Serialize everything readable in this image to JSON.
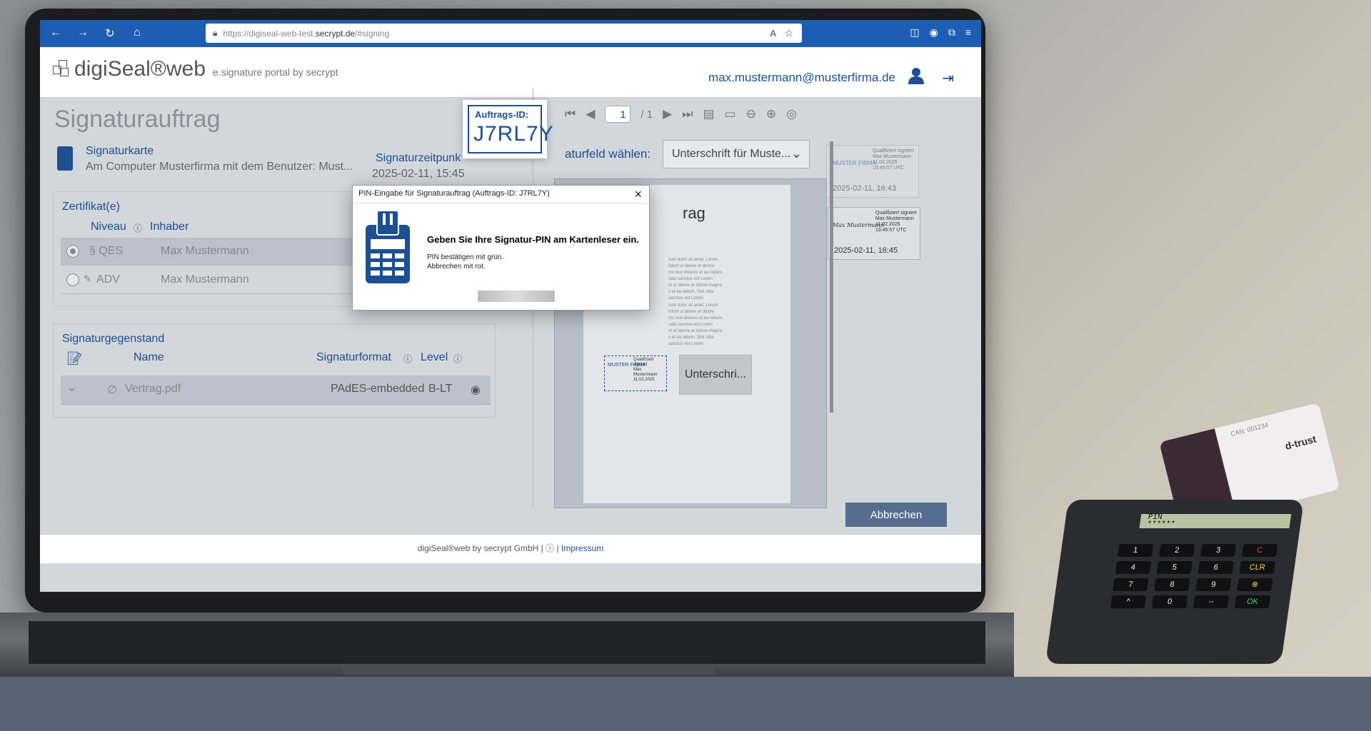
{
  "browser": {
    "url_prefix": "https://digiseal-web-test.",
    "url_domain": "secrypt.de",
    "url_path": "/#signing"
  },
  "header": {
    "logo_name": "digiSeal®web",
    "logo_sub": "e.signature portal by secrypt",
    "user_email": "max.mustermann@musterfirma.de"
  },
  "page": {
    "title": "Signaturauftrag",
    "card_label": "Signaturkarte",
    "card_desc": "Am Computer Musterfirma mit dem Benutzer: Must...",
    "sigtime_label": "Signaturzeitpunk",
    "sigtime_value": "2025-02-11, 15:45"
  },
  "certificates": {
    "title": "Zertifikat(e)",
    "col_level": "Niveau",
    "col_holder": "Inhaber",
    "rows": [
      {
        "level": "§ QES",
        "holder": "Max Mustermann",
        "selected": true
      },
      {
        "level": "ADV",
        "holder": "Max Mustermann",
        "selected": false
      }
    ]
  },
  "object": {
    "title": "Signaturgegenstand",
    "col_name": "Name",
    "col_format": "Signaturformat",
    "col_level": "Level",
    "row": {
      "name": "Vertrag.pdf",
      "format": "PAdES-embedded",
      "level": "B-LT"
    }
  },
  "viewer": {
    "page_current": "1",
    "page_total": "/ 1",
    "sigfield_label": "aturfeld wählen:",
    "sigfield_value": "Unterschrift für Muste...",
    "doc_title": "rag",
    "lorem": "sum dolor sit amet. Lorem\nlidunt ut labore et dolore\nmo duo dolores et ea rebum.\nsata sanctus est Lorem\nnt ut labore et dolore magna\ns et ea rebum. Stet clita\nsanctus est Lorem",
    "stamp1": "Qualifiziert signiert\nMax Mustermann\n11.02.2025",
    "stamp1_mark": "MUSTER FIRMA",
    "sig_button": "Unterschri..."
  },
  "thumbnails": [
    {
      "text": "Qualifiziert signiert\nMax Mustermann\n11.02.2025\n15:45:57 UTC",
      "date": "2025-02-11, 16:43",
      "mark": "MUSTER FIRMA"
    },
    {
      "text": "Qualifiziert signiert\nMax Mustermann\n11.02.2025\n15:45:57 UTC",
      "date": "2025-02-11, 16:45",
      "mark": "Max Mustermann"
    }
  ],
  "cancel_label": "Abbrechen",
  "footer": {
    "text": "digiSeal®web by secrypt GmbH |",
    "link": "Impressum"
  },
  "auftrag": {
    "label": "Auftrags-ID:",
    "value": "J7RL7Y"
  },
  "dialog": {
    "title": "PIN-Eingabe für Signaturauftrag (Auftrags-ID: J7RL7Y)",
    "heading": "Geben Sie Ihre Signatur-PIN am Kartenleser ein.",
    "line1": "PIN bestätigen mit grün.",
    "line2": "Abbrechen mit rot."
  },
  "reader": {
    "display": "PIN\n******",
    "keys": [
      "1",
      "2",
      "3",
      "C",
      "4",
      "5",
      "6",
      "CLR",
      "7",
      "8",
      "9",
      "⊗",
      "^",
      "0",
      "·-",
      "OK"
    ]
  },
  "chipcard": {
    "text": "CAN: 001234",
    "brand": "d-trust"
  },
  "colors": {
    "accent": "#1d4f91",
    "browser_bar": "#1d5eb3",
    "cancel_button": "#566d8f"
  }
}
